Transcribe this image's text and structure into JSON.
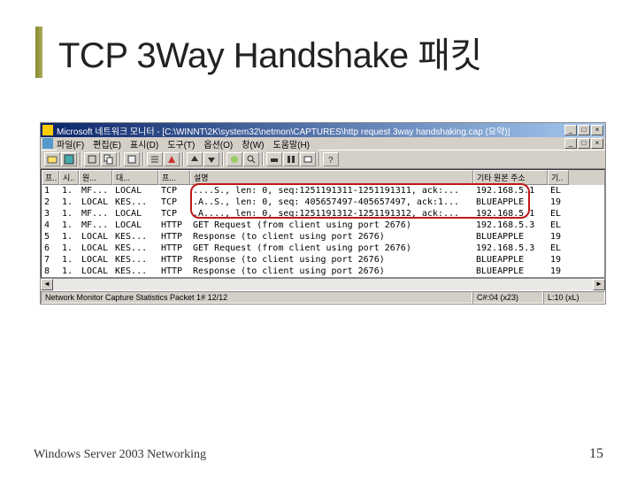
{
  "slide": {
    "title": "TCP 3Way Handshake 패킷",
    "footer": "Windows Server 2003 Networking",
    "page": "15"
  },
  "window": {
    "title": "Microsoft 네트워크 모니터 - [C:\\WINNT\\2K\\system32\\netmon\\CAPTURES\\http request 3way handshaking.cap (요약)]",
    "menus": [
      "파일(F)",
      "편집(E)",
      "표시(D)",
      "도구(T)",
      "옵션(O)",
      "창(W)",
      "도움말(H)"
    ],
    "columns": [
      "프..",
      "시..",
      "원...",
      "대...",
      "프...",
      "설명",
      "기타 원본 주소",
      "기.."
    ],
    "rows": [
      {
        "n": "1",
        "t": "1.",
        "src": "MF...",
        "dst": "LOCAL",
        "p": "TCP",
        "desc": "....S., len:    0, seq:1251191311-1251191311, ack:...",
        "addr": "192.168.5.1",
        "a2": "EL"
      },
      {
        "n": "2",
        "t": "1.",
        "src": "LOCAL",
        "dst": "KES...",
        "p": "TCP",
        "desc": ".A..S., len:    0, seq: 405657497-405657497, ack:1...",
        "addr": "BLUEAPPLE",
        "a2": "19"
      },
      {
        "n": "3",
        "t": "1.",
        "src": "MF...",
        "dst": "LOCAL",
        "p": "TCP",
        "desc": ".A...., len:    0, seq:1251191312-1251191312, ack:...",
        "addr": "192.168.5.1",
        "a2": "EL"
      },
      {
        "n": "4",
        "t": "1.",
        "src": "MF...",
        "dst": "LOCAL",
        "p": "HTTP",
        "desc": "GET Request (from client using port 2676)",
        "addr": "192.168.5.3",
        "a2": "EL"
      },
      {
        "n": "5",
        "t": "1.",
        "src": "LOCAL",
        "dst": "KES...",
        "p": "HTTP",
        "desc": "Response (to client using port 2676)",
        "addr": "BLUEAPPLE",
        "a2": "19"
      },
      {
        "n": "6",
        "t": "1.",
        "src": "LOCAL",
        "dst": "KES...",
        "p": "HTTP",
        "desc": "GET Request (from client using port 2676)",
        "addr": "192.168.5.3",
        "a2": "EL"
      },
      {
        "n": "7",
        "t": "1.",
        "src": "LOCAL",
        "dst": "KES...",
        "p": "HTTP",
        "desc": "Response (to client using port 2676)",
        "addr": "BLUEAPPLE",
        "a2": "19"
      },
      {
        "n": "8",
        "t": "1.",
        "src": "LOCAL",
        "dst": "KES...",
        "p": "HTTP",
        "desc": "Response (to client using port 2676)",
        "addr": "BLUEAPPLE",
        "a2": "19"
      }
    ],
    "status": {
      "left": "Network Monitor Capture Statistics Packet 1# 12/12",
      "mid": "C#:04 (x23)",
      "right": "L:10 (xL)"
    }
  }
}
